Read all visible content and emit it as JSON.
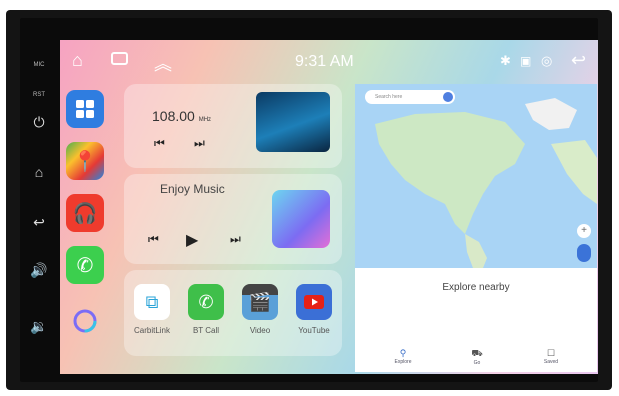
{
  "side_panel": {
    "mic_label": "MIC",
    "rst_label": "RST",
    "buttons": [
      "power-icon",
      "home-icon",
      "back-icon",
      "volume-up-icon",
      "volume-down-icon"
    ]
  },
  "status_bar": {
    "time": "9:31 AM",
    "left_icons": [
      "home-icon",
      "recent-apps-icon",
      "chevron-up-icon"
    ],
    "right_icons": [
      "bluetooth-icon",
      "signal-icon",
      "wifi-icon",
      "back-icon"
    ]
  },
  "dock": {
    "apps": [
      "app-drawer-icon",
      "maps-icon",
      "music-icon",
      "phone-icon",
      "assistant-icon"
    ]
  },
  "radio": {
    "frequency": "108.00",
    "unit": "MHz"
  },
  "music": {
    "title": "Enjoy Music"
  },
  "apps": [
    {
      "label": "CarbitLink",
      "icon": "carbitlink-icon",
      "color": "#ffffff"
    },
    {
      "label": "BT Call",
      "icon": "bt-call-icon",
      "color": "#3fbf4a"
    },
    {
      "label": "Video",
      "icon": "video-icon",
      "color": "#5aa0d8"
    },
    {
      "label": "YouTube",
      "icon": "youtube-icon",
      "color": "#3b6fd6"
    }
  ],
  "map": {
    "search_placeholder": "Search here",
    "explore": "Explore nearby",
    "tabs": [
      {
        "label": "Explore",
        "icon": "pin-icon"
      },
      {
        "label": "Go",
        "icon": "car-icon"
      },
      {
        "label": "Saved",
        "icon": "bookmark-icon"
      }
    ]
  }
}
